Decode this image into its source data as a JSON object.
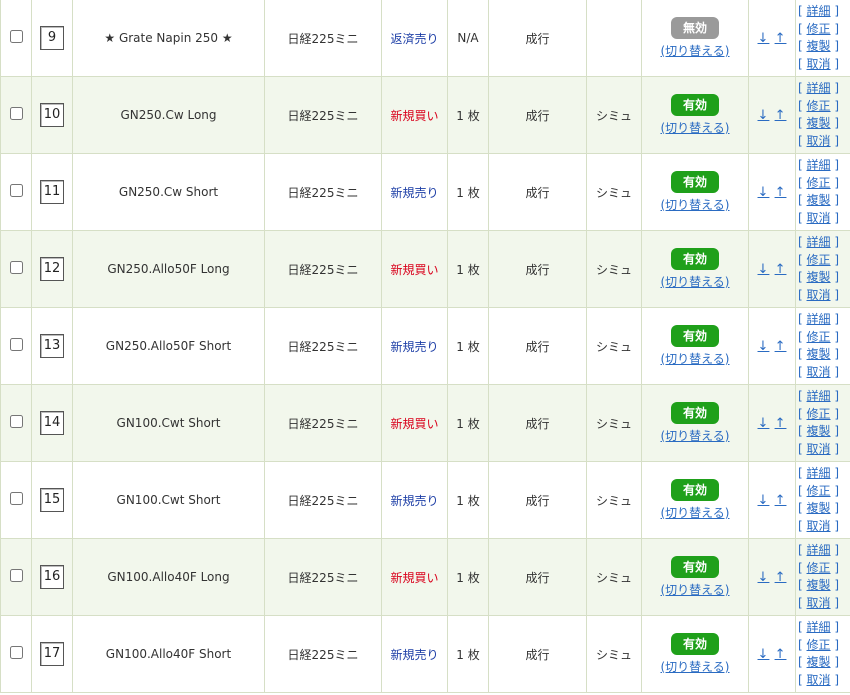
{
  "labels": {
    "toggle": "(切り替える)",
    "arrow_down": "↓",
    "arrow_up": "↑",
    "bracket_open": "[",
    "bracket_close": "]",
    "action_detail": "詳細",
    "action_edit": "修正",
    "action_copy": "複製",
    "action_cancel": "取消"
  },
  "colors": {
    "buy": "#d9001b",
    "sell": "#1d3ea6",
    "enabled_badge": "#1fa01a",
    "disabled_badge": "#9a9a9a",
    "link": "#2a6bc2",
    "row_shade": "#f2f7ec"
  },
  "rows": [
    {
      "order": "9",
      "name": "★ Grate Napin 250 ★",
      "market": "日経225ミニ",
      "side": "返済売り",
      "side_type": "close",
      "qty": "N/A",
      "exec": "成行",
      "mode": "",
      "status": "無効",
      "enabled": false
    },
    {
      "order": "10",
      "name": "GN250.Cw Long",
      "market": "日経225ミニ",
      "side": "新規買い",
      "side_type": "buy",
      "qty": "1 枚",
      "exec": "成行",
      "mode": "シミュ",
      "status": "有効",
      "enabled": true
    },
    {
      "order": "11",
      "name": "GN250.Cw Short",
      "market": "日経225ミニ",
      "side": "新規売り",
      "side_type": "sell",
      "qty": "1 枚",
      "exec": "成行",
      "mode": "シミュ",
      "status": "有効",
      "enabled": true
    },
    {
      "order": "12",
      "name": "GN250.Allo50F Long",
      "market": "日経225ミニ",
      "side": "新規買い",
      "side_type": "buy",
      "qty": "1 枚",
      "exec": "成行",
      "mode": "シミュ",
      "status": "有効",
      "enabled": true
    },
    {
      "order": "13",
      "name": "GN250.Allo50F Short",
      "market": "日経225ミニ",
      "side": "新規売り",
      "side_type": "sell",
      "qty": "1 枚",
      "exec": "成行",
      "mode": "シミュ",
      "status": "有効",
      "enabled": true
    },
    {
      "order": "14",
      "name": "GN100.Cwt Short",
      "market": "日経225ミニ",
      "side": "新規買い",
      "side_type": "buy",
      "qty": "1 枚",
      "exec": "成行",
      "mode": "シミュ",
      "status": "有効",
      "enabled": true
    },
    {
      "order": "15",
      "name": "GN100.Cwt Short",
      "market": "日経225ミニ",
      "side": "新規売り",
      "side_type": "sell",
      "qty": "1 枚",
      "exec": "成行",
      "mode": "シミュ",
      "status": "有効",
      "enabled": true
    },
    {
      "order": "16",
      "name": "GN100.Allo40F Long",
      "market": "日経225ミニ",
      "side": "新規買い",
      "side_type": "buy",
      "qty": "1 枚",
      "exec": "成行",
      "mode": "シミュ",
      "status": "有効",
      "enabled": true
    },
    {
      "order": "17",
      "name": "GN100.Allo40F Short",
      "market": "日経225ミニ",
      "side": "新規売り",
      "side_type": "sell",
      "qty": "1 枚",
      "exec": "成行",
      "mode": "シミュ",
      "status": "有効",
      "enabled": true
    }
  ]
}
